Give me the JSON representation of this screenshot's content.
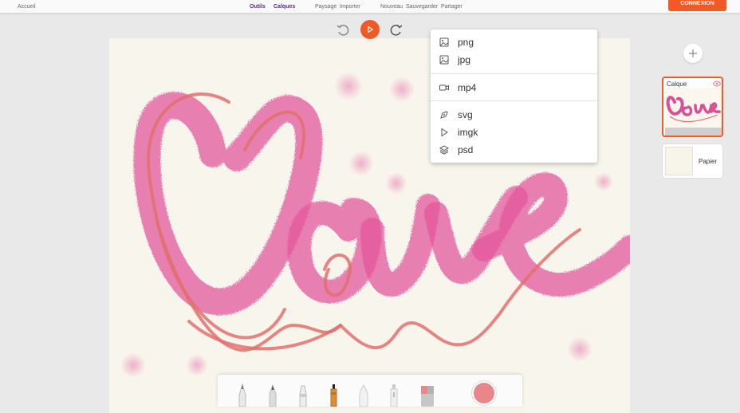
{
  "topbar": {
    "home": "Accueil",
    "tools": "Outils",
    "layers": "Calques",
    "landscape": "Paysage",
    "import": "Importer",
    "new": "Nouveau",
    "save": "Sauvegarder",
    "share": "Partager",
    "login": "CONNEXION"
  },
  "controls": {
    "undo_icon": "undo-icon",
    "play_icon": "play-icon",
    "redo_icon": "redo-icon"
  },
  "share_menu": {
    "items": [
      {
        "label": "png",
        "icon": "image-icon"
      },
      {
        "label": "jpg",
        "icon": "image-icon"
      },
      {
        "label": "mp4",
        "icon": "video-icon"
      },
      {
        "label": "svg",
        "icon": "pen-tool-icon"
      },
      {
        "label": "imgk",
        "icon": "play-outline-icon"
      },
      {
        "label": "psd",
        "icon": "layers-icon"
      }
    ]
  },
  "layers_panel": {
    "add_icon": "plus-icon",
    "layer_name": "Calque",
    "paper_name": "Papier"
  },
  "toolbar": {
    "tools": [
      "pencil",
      "pen",
      "marker",
      "brush",
      "felt-tip",
      "airbrush",
      "eraser"
    ],
    "current_color": "#e8868a"
  },
  "colors": {
    "accent": "#f15a24",
    "active_nav": "#5b2a86",
    "paper": "#f8f6ec",
    "ink_pink": "#e3559c",
    "ink_coral": "#e2706f"
  }
}
